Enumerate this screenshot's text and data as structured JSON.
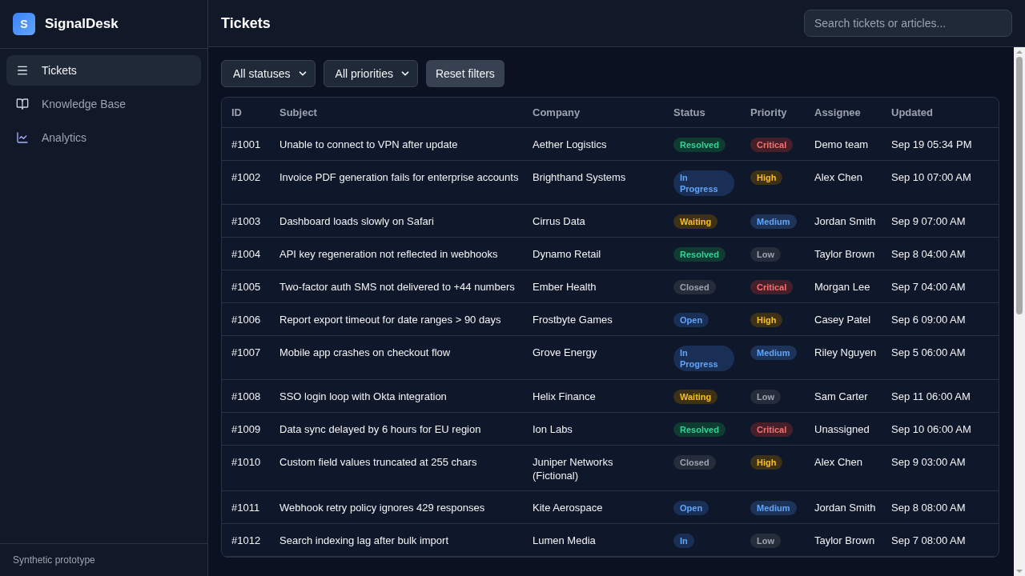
{
  "brand": {
    "logo": "S",
    "name": "SignalDesk"
  },
  "nav": [
    {
      "label": "Tickets",
      "selected": true
    },
    {
      "label": "Knowledge Base",
      "selected": false
    },
    {
      "label": "Analytics",
      "selected": false
    }
  ],
  "footer": "Synthetic prototype",
  "header": {
    "title": "Tickets",
    "search": {
      "placeholder": "Search tickets or articles..."
    }
  },
  "filters": {
    "status": "All statuses",
    "priority": "All priorities",
    "reset": "Reset filters"
  },
  "table": {
    "columns": [
      "ID",
      "Subject",
      "Company",
      "Status",
      "Priority",
      "Assignee",
      "Updated"
    ],
    "rows": [
      {
        "id": "#1001",
        "subject": "Unable to connect to VPN after update",
        "company": "Aether Logistics",
        "status": {
          "label": "Resolved",
          "kind": "resolved"
        },
        "priority": {
          "label": "Critical",
          "kind": "critical"
        },
        "assignee": "Demo team",
        "updated": "Sep 19 05:34 PM"
      },
      {
        "id": "#1002",
        "subject": "Invoice PDF generation fails for enterprise accounts",
        "company": "Brighthand Systems",
        "status": {
          "label": "In Progress",
          "kind": "progress"
        },
        "priority": {
          "label": "High",
          "kind": "high"
        },
        "assignee": "Alex Chen",
        "updated": "Sep 10 07:00 AM"
      },
      {
        "id": "#1003",
        "subject": "Dashboard loads slowly on Safari",
        "company": "Cirrus Data",
        "status": {
          "label": "Waiting",
          "kind": "waiting"
        },
        "priority": {
          "label": "Medium",
          "kind": "medium"
        },
        "assignee": "Jordan Smith",
        "updated": "Sep 9 07:00 AM"
      },
      {
        "id": "#1004",
        "subject": "API key regeneration not reflected in webhooks",
        "company": "Dynamo Retail",
        "status": {
          "label": "Resolved",
          "kind": "resolved"
        },
        "priority": {
          "label": "Low",
          "kind": "low"
        },
        "assignee": "Taylor Brown",
        "updated": "Sep 8 04:00 AM"
      },
      {
        "id": "#1005",
        "subject": "Two-factor auth SMS not delivered to +44 numbers",
        "company": "Ember Health",
        "status": {
          "label": "Closed",
          "kind": "closed"
        },
        "priority": {
          "label": "Critical",
          "kind": "critical"
        },
        "assignee": "Morgan Lee",
        "updated": "Sep 7 04:00 AM"
      },
      {
        "id": "#1006",
        "subject": "Report export timeout for date ranges > 90 days",
        "company": "Frostbyte Games",
        "status": {
          "label": "Open",
          "kind": "open"
        },
        "priority": {
          "label": "High",
          "kind": "high"
        },
        "assignee": "Casey Patel",
        "updated": "Sep 6 09:00 AM"
      },
      {
        "id": "#1007",
        "subject": "Mobile app crashes on checkout flow",
        "company": "Grove Energy",
        "status": {
          "label": "In Progress",
          "kind": "progress"
        },
        "priority": {
          "label": "Medium",
          "kind": "medium"
        },
        "assignee": "Riley Nguyen",
        "updated": "Sep 5 06:00 AM"
      },
      {
        "id": "#1008",
        "subject": "SSO login loop with Okta integration",
        "company": "Helix Finance",
        "status": {
          "label": "Waiting",
          "kind": "waiting"
        },
        "priority": {
          "label": "Low",
          "kind": "low"
        },
        "assignee": "Sam Carter",
        "updated": "Sep 11 06:00 AM"
      },
      {
        "id": "#1009",
        "subject": "Data sync delayed by 6 hours for EU region",
        "company": "Ion Labs",
        "status": {
          "label": "Resolved",
          "kind": "resolved"
        },
        "priority": {
          "label": "Critical",
          "kind": "critical"
        },
        "assignee": "Unassigned",
        "updated": "Sep 10 06:00 AM"
      },
      {
        "id": "#1010",
        "subject": "Custom field values truncated at 255 chars",
        "company": "Juniper Networks (Fictional)",
        "status": {
          "label": "Closed",
          "kind": "closed"
        },
        "priority": {
          "label": "High",
          "kind": "high"
        },
        "assignee": "Alex Chen",
        "updated": "Sep 9 03:00 AM"
      },
      {
        "id": "#1011",
        "subject": "Webhook retry policy ignores 429 responses",
        "company": "Kite Aerospace",
        "status": {
          "label": "Open",
          "kind": "open"
        },
        "priority": {
          "label": "Medium",
          "kind": "medium"
        },
        "assignee": "Jordan Smith",
        "updated": "Sep 8 08:00 AM"
      },
      {
        "id": "#1012",
        "subject": "Search indexing lag after bulk import",
        "company": "Lumen Media",
        "status": {
          "label": "In",
          "kind": "progress"
        },
        "priority": {
          "label": "Low",
          "kind": "low"
        },
        "assignee": "Taylor Brown",
        "updated": "Sep 7 08:00 AM"
      }
    ]
  }
}
